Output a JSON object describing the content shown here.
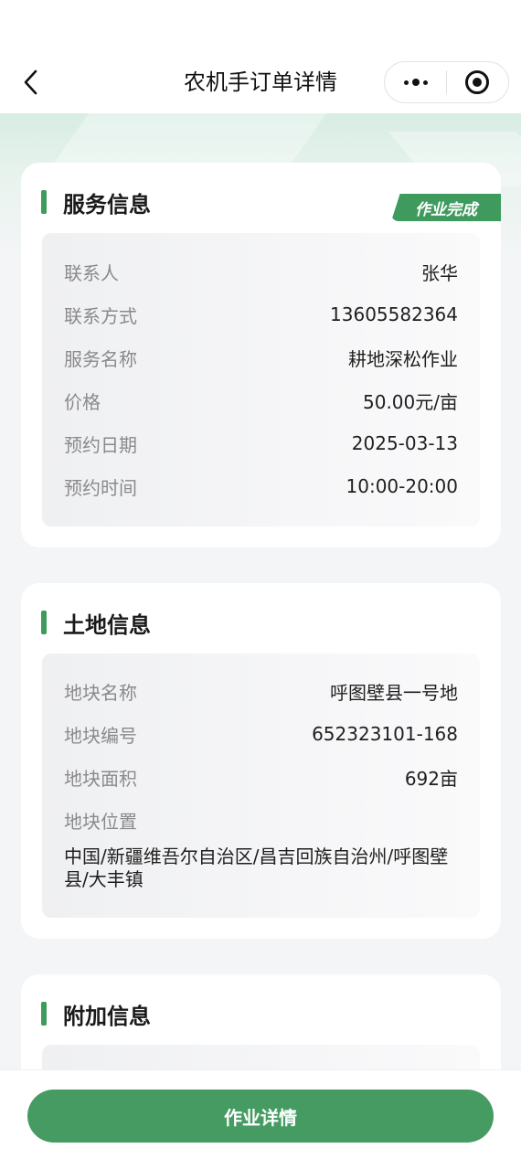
{
  "nav": {
    "title": "农机手订单详情"
  },
  "service": {
    "title": "服务信息",
    "status": "作业完成",
    "rows": [
      {
        "label": "联系人",
        "value": "张华"
      },
      {
        "label": "联系方式",
        "value": "13605582364"
      },
      {
        "label": "服务名称",
        "value": "耕地深松作业"
      },
      {
        "label": "价格",
        "value": "50.00元/亩"
      },
      {
        "label": "预约日期",
        "value": "2025-03-13"
      },
      {
        "label": "预约时间",
        "value": "10:00-20:00"
      }
    ]
  },
  "land": {
    "title": "土地信息",
    "rows": [
      {
        "label": "地块名称",
        "value": "呼图壁县一号地"
      },
      {
        "label": "地块编号",
        "value": "652323101-168"
      },
      {
        "label": "地块面积",
        "value": "692亩"
      }
    ],
    "location_label": "地块位置",
    "location_value": "中国/新疆维吾尔自治区/昌吉回族自治州/呼图壁县/大丰镇"
  },
  "extra": {
    "title": "附加信息"
  },
  "footer": {
    "button_label": "作业详情"
  },
  "colors": {
    "accent": "#3f9a5e",
    "button": "#459b62"
  }
}
